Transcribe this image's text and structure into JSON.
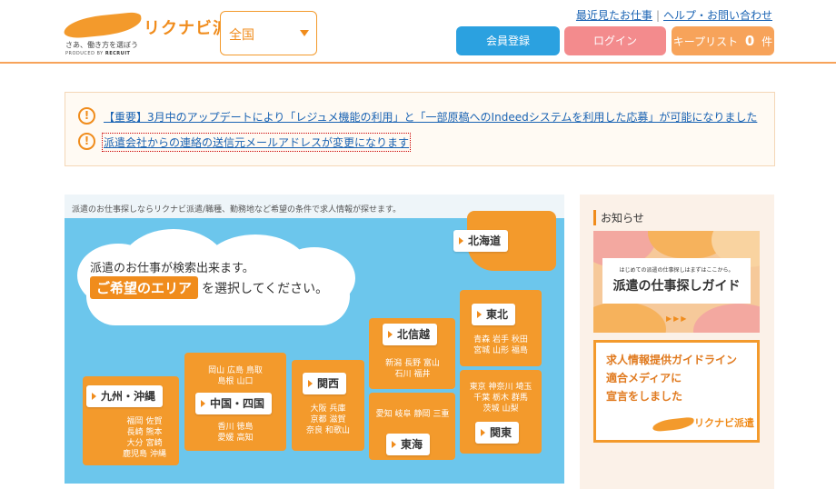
{
  "header": {
    "logo_text": "リクナビ派遣",
    "logo_tagline": "さあ、働き方を選ぼう",
    "logo_produced": "PRODUCED BY",
    "logo_recruit": "RECRUIT",
    "area_value": "全国",
    "links": [
      "最近見たお仕事",
      "ヘルプ・お問い合わせ"
    ],
    "register_label": "会員登録",
    "login_label": "ログイン",
    "keep_label": "キープリスト",
    "keep_count": "0",
    "keep_unit": "件"
  },
  "notices": [
    "【重要】3月中のアップデートにより「レジュメ機能の利用」と「一部原稿へのIndeedシステムを利用した応募」が可能になりました",
    "派遣会社からの連絡の送信元メールアドレスが変更になります"
  ],
  "map": {
    "caption": "派遣のお仕事探しならリクナビ派遣/職種、勤務地など希望の条件で求人情報が探せます。",
    "prompt_line1": "派遣のお仕事が検索出来ます。",
    "prompt_highlight": "ご希望のエリア",
    "prompt_rest": "を選択してください。",
    "regions": {
      "hokkaido": {
        "label": "北海道",
        "prefs": []
      },
      "tohoku": {
        "label": "東北",
        "prefs": [
          "青森",
          "岩手",
          "秋田",
          "宮城",
          "山形",
          "福島"
        ]
      },
      "kanto": {
        "label": "関東",
        "prefs": [
          "東京",
          "神奈川",
          "埼玉",
          "千葉",
          "栃木",
          "群馬",
          "茨城",
          "山梨"
        ]
      },
      "hokushinetsu": {
        "label": "北信越",
        "prefs": [
          "新潟",
          "長野",
          "富山",
          "石川",
          "福井"
        ]
      },
      "tokai": {
        "label": "東海",
        "prefs": [
          "愛知",
          "岐阜",
          "静岡",
          "三重"
        ]
      },
      "kansai": {
        "label": "関西",
        "prefs": [
          "大阪",
          "兵庫",
          "京都",
          "滋賀",
          "奈良",
          "和歌山"
        ]
      },
      "chugoku_shikoku": {
        "label": "中国・四国",
        "prefs_top": [
          "岡山",
          "広島",
          "鳥取",
          "島根",
          "山口"
        ],
        "prefs_bottom": [
          "香川",
          "徳島",
          "愛媛",
          "高知"
        ]
      },
      "kyushu": {
        "label": "九州・沖縄",
        "prefs": [
          "福岡",
          "佐賀",
          "長崎",
          "熊本",
          "大分",
          "宮崎",
          "鹿児島",
          "沖縄"
        ]
      }
    }
  },
  "sidebar": {
    "title": "お知らせ",
    "banner1_small": "はじめての派遣の仕事探しはまずはここから。",
    "banner1_big": "派遣の仕事探しガイド",
    "banner1_arrows": "▶▶▶",
    "banner2_lines": [
      "求人情報提供ガイドライン",
      "適合メディアに",
      "宣言をしました"
    ],
    "banner2_logo": "リクナビ派遣"
  },
  "colors": {
    "accent_orange": "#f39a2c",
    "register_blue": "#2ba1e0",
    "login_pink": "#f38b8d",
    "keep_orange": "#f7a35a",
    "map_sky": "#6cc6ec",
    "link_blue": "#1a63b3"
  }
}
